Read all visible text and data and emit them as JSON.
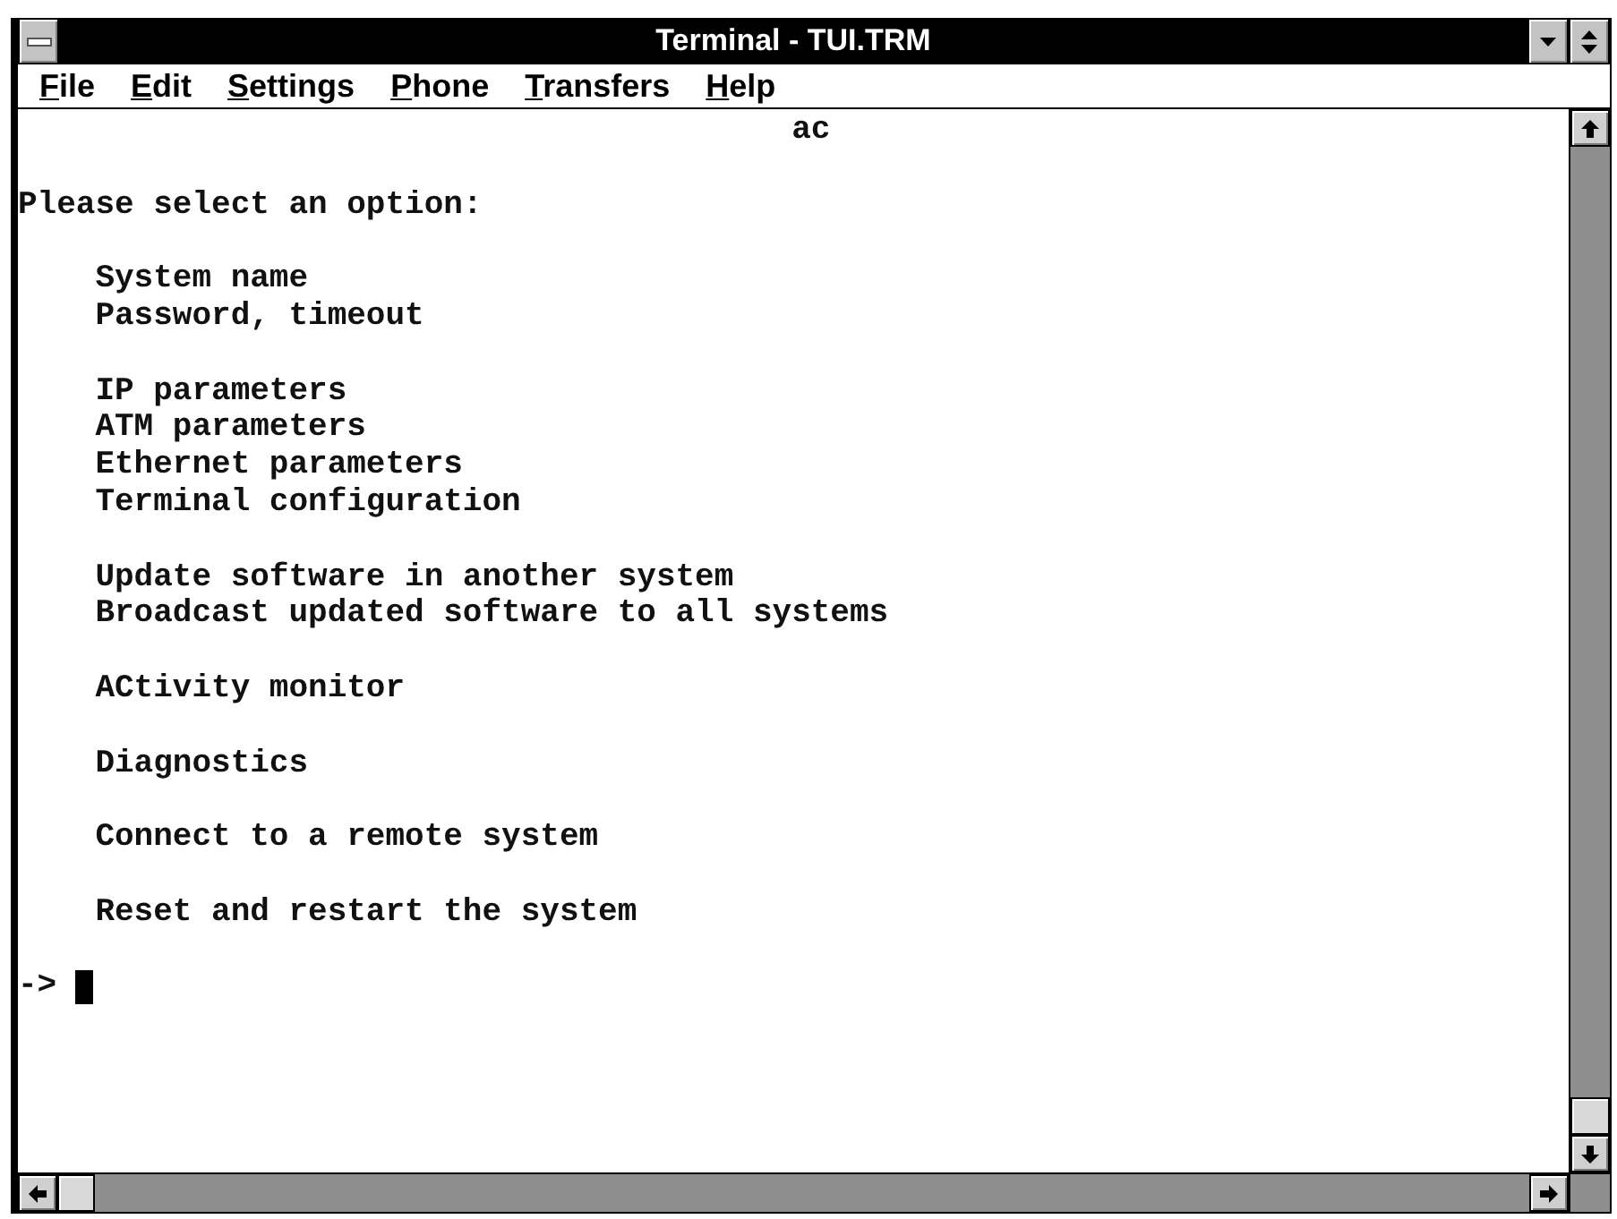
{
  "window": {
    "title": "Terminal - TUI.TRM"
  },
  "menu_bar": [
    "File",
    "Edit",
    "Settings",
    "Phone",
    "Transfers",
    "Help"
  ],
  "terminal": {
    "header": "ac",
    "instruction": "Please select an option:",
    "option_groups": [
      [
        "System name",
        "Password, timeout"
      ],
      [
        "IP parameters",
        "ATM parameters",
        "Ethernet parameters",
        "Terminal configuration"
      ],
      [
        "Update software in another system",
        "Broadcast updated software to all systems"
      ],
      [
        "ACtivity monitor"
      ],
      [
        "Diagnostics"
      ],
      [
        "Connect to a remote system"
      ],
      [
        "Reset and restart the system"
      ]
    ],
    "prompt": "->",
    "cursor": true
  }
}
